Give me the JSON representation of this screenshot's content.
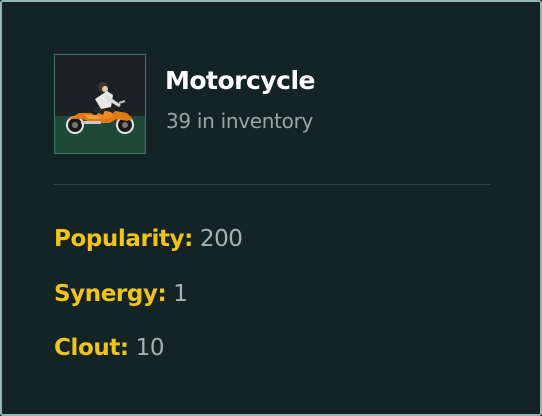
{
  "item": {
    "name": "Motorcycle",
    "inventory_text": "39 in inventory",
    "icon": "motorcycle-rider-icon"
  },
  "stats": [
    {
      "label": "Popularity:",
      "value": "200"
    },
    {
      "label": "Synergy:",
      "value": "1"
    },
    {
      "label": "Clout:",
      "value": "10"
    }
  ],
  "colors": {
    "panel_background": "#142424",
    "panel_border": "#8fb8b4",
    "stat_label": "#f0c419",
    "stat_value": "#a9b1b0",
    "item_name": "#ffffff",
    "inventory_text": "#9aa6a4"
  }
}
